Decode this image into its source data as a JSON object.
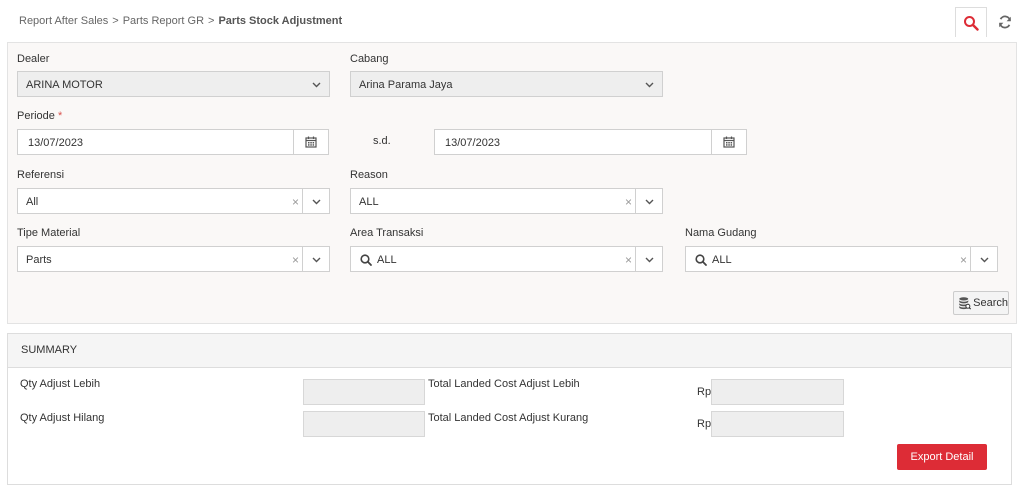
{
  "breadcrumb": {
    "items": [
      "Report After Sales",
      "Parts Report GR"
    ],
    "current": "Parts Stock Adjustment",
    "separator": ">"
  },
  "toolbar": {
    "search_icon": "search-icon",
    "refresh_icon": "refresh-icon"
  },
  "filters": {
    "dealer": {
      "label": "Dealer",
      "value": "ARINA MOTOR"
    },
    "cabang": {
      "label": "Cabang",
      "value": "Arina Parama Jaya"
    },
    "periode": {
      "label": "Periode",
      "required_mark": "*",
      "from": "13/07/2023",
      "sd_label": "s.d.",
      "to": "13/07/2023"
    },
    "referensi": {
      "label": "Referensi",
      "value": "All"
    },
    "reason": {
      "label": "Reason",
      "value": "ALL"
    },
    "tipe_material": {
      "label": "Tipe Material",
      "value": "Parts"
    },
    "area_transaksi": {
      "label": "Area Transaksi",
      "value": "ALL"
    },
    "nama_gudang": {
      "label": "Nama Gudang",
      "value": "ALL"
    },
    "clear_glyph": "×",
    "search_button": "Search"
  },
  "summary": {
    "title": "SUMMARY",
    "qty_lebih_label": "Qty Adjust Lebih",
    "qty_hilang_label": "Qty Adjust Hilang",
    "total_lebih_label": "Total Landed Cost Adjust Lebih",
    "total_kurang_label": "Total Landed Cost Adjust Kurang",
    "currency": "Rp",
    "export_button": "Export Detail"
  },
  "colors": {
    "accent": "#dd2c36",
    "panel_bg": "#faf8f7"
  }
}
